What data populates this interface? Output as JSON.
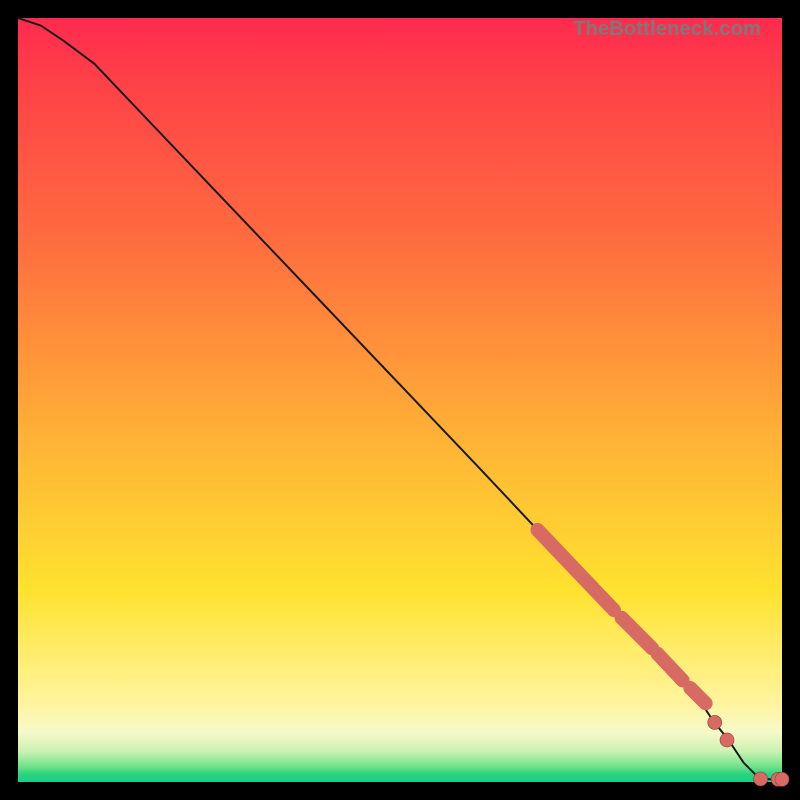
{
  "attribution": "TheBottleneck.com",
  "chart_data": {
    "type": "line",
    "title": "",
    "xlabel": "",
    "ylabel": "",
    "xlim": [
      0,
      100
    ],
    "ylim": [
      0,
      100
    ],
    "series": [
      {
        "name": "bottleneck-curve",
        "x": [
          0,
          3,
          6,
          10,
          20,
          30,
          40,
          50,
          60,
          68,
          70,
          72,
          74,
          76,
          78,
          80,
          81,
          82,
          83,
          84,
          85,
          87,
          89,
          91,
          93,
          95,
          97,
          99,
          100
        ],
        "y": [
          100,
          99,
          97,
          94,
          83.5,
          73,
          62.5,
          52,
          41.5,
          33,
          31,
          29,
          27,
          25,
          23,
          21,
          20,
          19,
          18,
          17,
          15.5,
          13,
          11,
          8,
          5.5,
          2.5,
          0.5,
          0.3,
          0.3
        ]
      }
    ],
    "markers": {
      "name": "highlighted-points",
      "color": "#d86a64",
      "strokes": [
        {
          "x0": 68,
          "y0": 33,
          "x1": 78,
          "y1": 22.5
        },
        {
          "x0": 79,
          "y0": 21.5,
          "x1": 83,
          "y1": 17.5
        },
        {
          "x0": 83.7,
          "y0": 16.8,
          "x1": 87,
          "y1": 13.3
        },
        {
          "x0": 88,
          "y0": 12.3,
          "x1": 90,
          "y1": 10.3
        }
      ],
      "dots": [
        {
          "x": 91.2,
          "y": 7.8
        },
        {
          "x": 92.8,
          "y": 5.5
        },
        {
          "x": 97.2,
          "y": 0.4
        },
        {
          "x": 99.5,
          "y": 0.35
        },
        {
          "x": 100,
          "y": 0.35
        }
      ]
    }
  }
}
